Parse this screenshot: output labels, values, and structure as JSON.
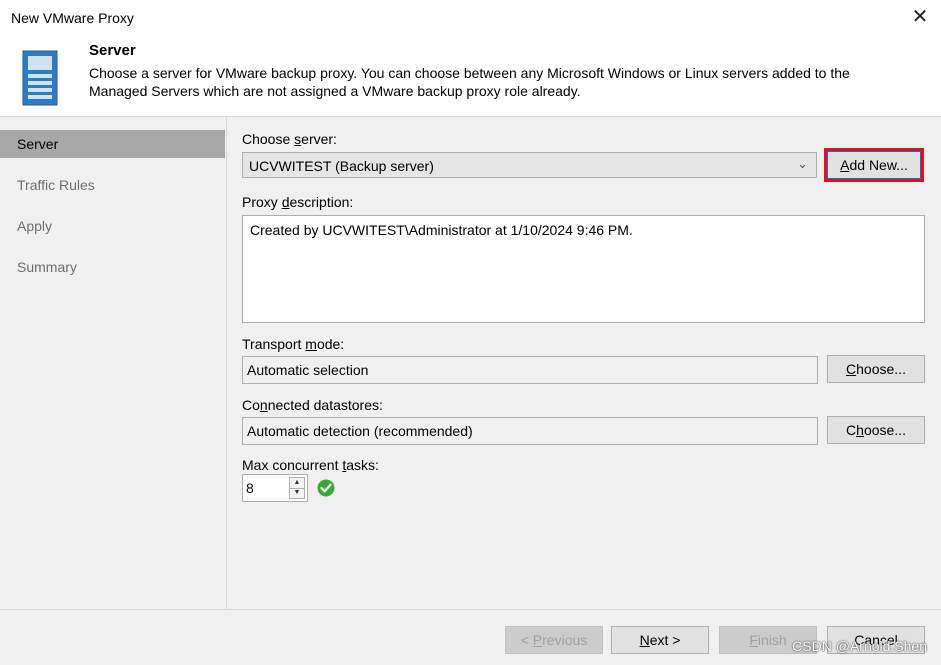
{
  "window": {
    "title": "New VMware Proxy"
  },
  "header": {
    "title": "Server",
    "description": "Choose a server for VMware backup proxy. You can choose between any Microsoft Windows or Linux servers added to the Managed Servers which are not assigned a VMware backup proxy role already.",
    "icon": "server-icon"
  },
  "sidebar": {
    "items": [
      {
        "label": "Server",
        "active": true
      },
      {
        "label": "Traffic Rules",
        "active": false
      },
      {
        "label": "Apply",
        "active": false
      },
      {
        "label": "Summary",
        "active": false
      }
    ]
  },
  "form": {
    "choose_server": {
      "label_pre": "Choose ",
      "label_u": "s",
      "label_post": "erver:",
      "value": "UCVWITEST (Backup server)"
    },
    "add_new": {
      "u": "A",
      "rest": "dd New..."
    },
    "proxy_description": {
      "label_pre": "Proxy ",
      "label_u": "d",
      "label_post": "escription:",
      "value": "Created by UCVWITEST\\Administrator at 1/10/2024 9:46 PM."
    },
    "transport_mode": {
      "label_pre": "Transport ",
      "label_u": "m",
      "label_post": "ode:",
      "value": "Automatic selection"
    },
    "connected_datastores": {
      "label_pre": "Co",
      "label_u": "n",
      "label_post": "nected datastores:",
      "value": "Automatic detection (recommended)"
    },
    "max_tasks": {
      "label_pre": "Max concurrent ",
      "label_u": "t",
      "label_post": "asks:",
      "value": "8"
    },
    "choose_btn_1": {
      "u": "C",
      "rest": "hoose..."
    },
    "choose_btn_2": {
      "pre": "C",
      "u": "h",
      "rest": "oose..."
    }
  },
  "footer": {
    "previous": {
      "pre": "< ",
      "u": "P",
      "rest": "revious"
    },
    "next": {
      "u": "N",
      "rest": "ext >"
    },
    "finish": {
      "u": "F",
      "rest": "inish"
    },
    "cancel": "Cancel"
  },
  "watermark": "CSDN @Arnold.Shen",
  "colors": {
    "highlight": "#e0101e",
    "accent": "#0078d7",
    "ok": "#3aa838"
  }
}
